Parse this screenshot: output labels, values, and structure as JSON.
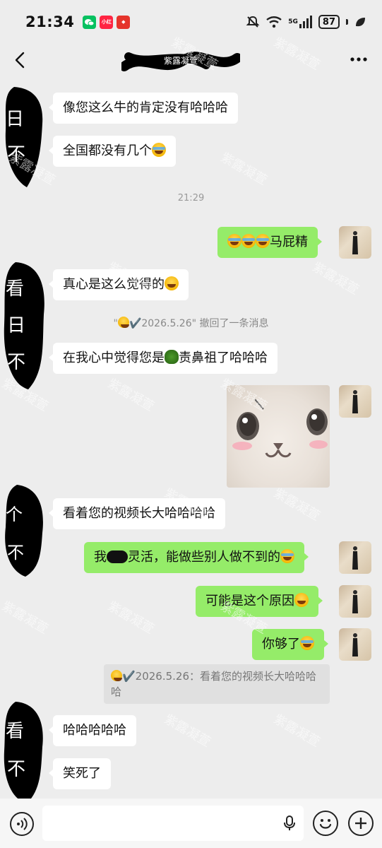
{
  "status_bar": {
    "time": "21:34",
    "network": "5G",
    "battery": "87"
  },
  "nav": {
    "back_icon": "back-chevron-icon",
    "more_icon": "more-dots-icon"
  },
  "messages": [
    {
      "side": "left",
      "text": "像您这么牛的肯定没有哈哈哈"
    },
    {
      "side": "left",
      "text": "全国都没有几个"
    },
    {
      "type": "timestamp",
      "text": "21:29"
    },
    {
      "side": "right",
      "text": "马屁精"
    },
    {
      "side": "left",
      "text": "真心是这么觉得的"
    },
    {
      "type": "system",
      "text": "撤回了一条消息",
      "name": "✔️2026.5.26\""
    },
    {
      "side": "left",
      "text_before": "在我心中觉得您是",
      "text_after": "责鼻祖了哈哈哈"
    },
    {
      "side": "right",
      "type": "sticker"
    },
    {
      "side": "left",
      "text": "看着您的视频长大哈哈哈哈"
    },
    {
      "side": "right",
      "text_before": "我",
      "text_after": "灵活，能做些别人做不到的"
    },
    {
      "side": "right",
      "text": "可能是这个原因"
    },
    {
      "side": "right",
      "text": "你够了"
    },
    {
      "type": "quote",
      "text": "✔️2026.5.26：看着您的视频长大哈哈哈哈"
    },
    {
      "side": "left",
      "text": "哈哈哈哈哈"
    },
    {
      "side": "left",
      "text": "笑死了"
    }
  ],
  "watermark": "紫露凝萱",
  "input": {
    "placeholder": "",
    "value": ""
  }
}
